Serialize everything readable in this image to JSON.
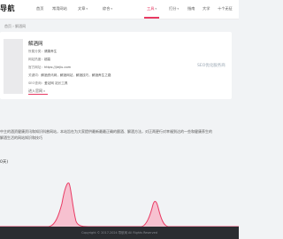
{
  "header": {
    "logo": "导航",
    "nav": [
      {
        "label": "首页",
        "caret": false
      },
      {
        "label": "常用网站",
        "caret": false
      },
      {
        "label": "文章",
        "caret": true
      },
      {
        "label": "综合",
        "caret": true
      },
      {
        "label": "工具",
        "caret": true
      },
      {
        "label": "打分",
        "caret": true
      },
      {
        "label": "指南",
        "caret": false
      },
      {
        "label": "大学",
        "caret": false
      },
      {
        "label": "十个无征",
        "caret": false
      }
    ],
    "active_index": 3,
    "accent_color": "#e83a63"
  },
  "breadcrumb": "首页 › 解酒网",
  "site_card": {
    "name": "解酒网",
    "rows": [
      {
        "label": "所属分类：",
        "value": "健康养生"
      },
      {
        "label": "网站热度：",
        "value": "超高"
      },
      {
        "label": "官方网址：",
        "value": "https://jiejiu.com"
      },
      {
        "label": "关键词：",
        "value": "解酒资讯网，解酒网站，解酒技巧，解酒养生之路"
      },
      {
        "label": "SEO查询：",
        "value": "爱站网    站长工具"
      }
    ],
    "visit_link": "进入官网",
    "visit_arrow": "»",
    "seo_badge": "SEO优化服务商"
  },
  "description": {
    "line1": "中主的酒资健康资讯和知识科普网站，本站旨在为大家提供最新最最正确的酿酒、解酒方法，对正两更行对幸福到达的一些和健康养生的",
    "line2": "解酒生活的网站知识和技巧"
  },
  "chart_section": {
    "title": "0天)"
  },
  "footer": {
    "text": "Copyright © 2017-2024  导航网  All Rights Reserved"
  }
}
